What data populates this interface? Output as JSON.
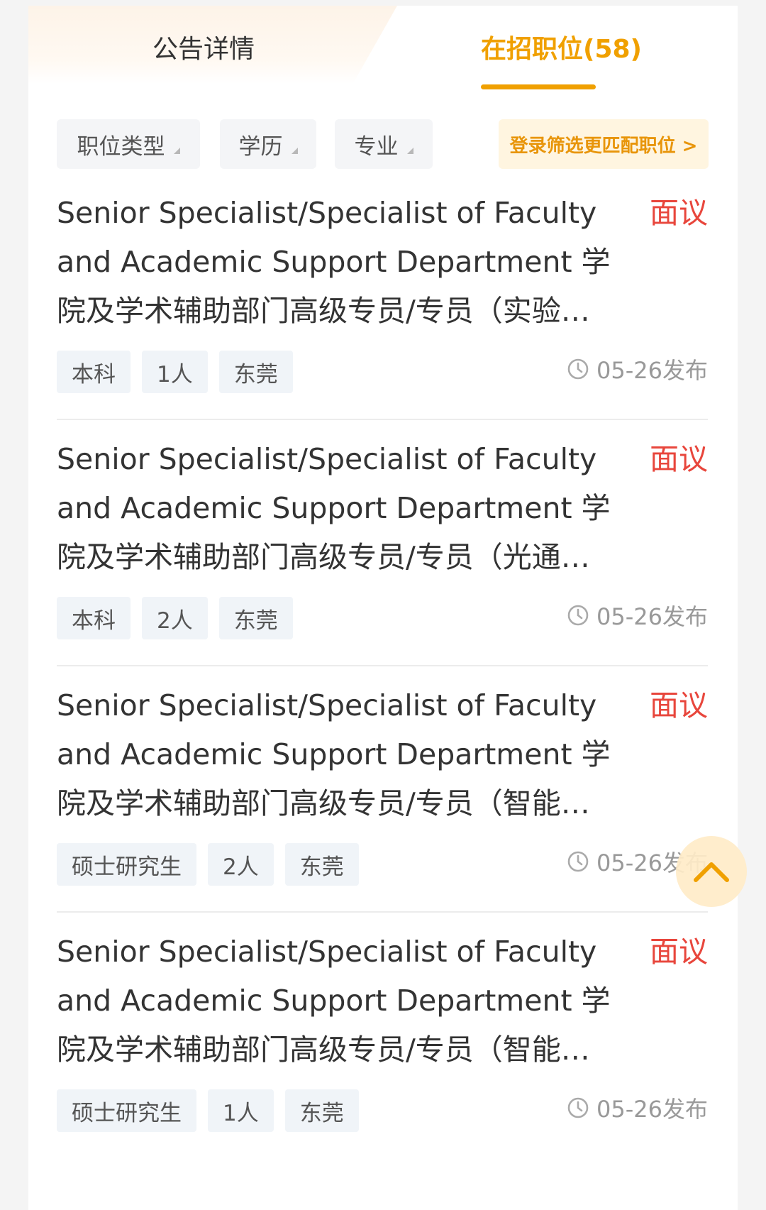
{
  "tabs": {
    "detail_label": "公告详情",
    "positions_label": "在招职位(58)"
  },
  "filters": {
    "type_label": "职位类型",
    "education_label": "学历",
    "major_label": "专业",
    "login_match_label": "登录筛选更匹配职位 >"
  },
  "jobs": [
    {
      "title": "Senior Specialist/Specialist of Faculty and Academic Support Department 学院及学术辅助部门高级专员/专员（实验…",
      "salary": "面议",
      "tags": [
        "本科",
        "1人",
        "东莞"
      ],
      "date": "05-26发布"
    },
    {
      "title": "Senior Specialist/Specialist of Faculty and Academic Support Department 学院及学术辅助部门高级专员/专员（光通…",
      "salary": "面议",
      "tags": [
        "本科",
        "2人",
        "东莞"
      ],
      "date": "05-26发布"
    },
    {
      "title": "Senior Specialist/Specialist of Faculty and Academic Support Department 学院及学术辅助部门高级专员/专员（智能…",
      "salary": "面议",
      "tags": [
        "硕士研究生",
        "2人",
        "东莞"
      ],
      "date": "05-26发布"
    },
    {
      "title": "Senior Specialist/Specialist of Faculty and Academic Support Department 学院及学术辅助部门高级专员/专员（智能…",
      "salary": "面议",
      "tags": [
        "硕士研究生",
        "1人",
        "东莞"
      ],
      "date": "05-26发布"
    }
  ],
  "colors": {
    "accent": "#f0a000",
    "salary": "#e8463c",
    "meta": "#999999"
  },
  "icons": {
    "date": "clock-icon",
    "back_to_top": "chevron-up-icon",
    "filter_caret": "caret-down-icon"
  }
}
